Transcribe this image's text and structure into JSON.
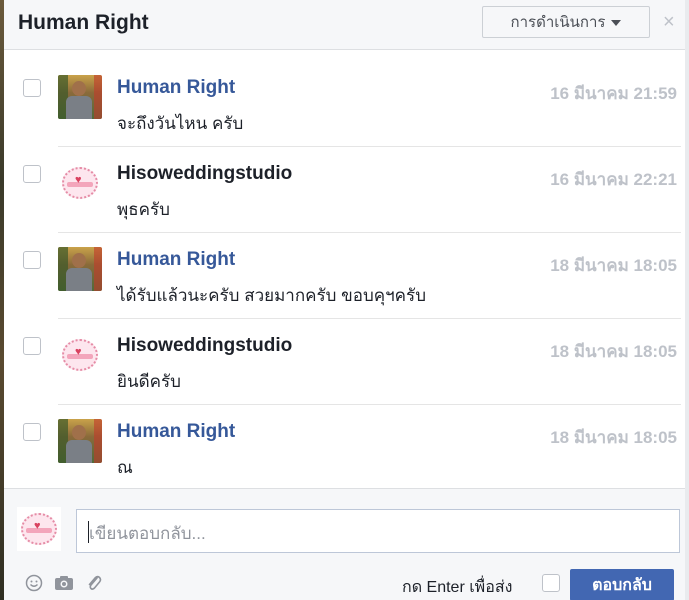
{
  "header": {
    "title": "Human Right",
    "actions_label": "การดำเนินการ",
    "close_symbol": "×"
  },
  "messages": [
    {
      "sender": "Human Right",
      "sender_type": "link",
      "avatar": "person-photo",
      "time": "16 มีนาคม 21:59",
      "text": "จะถึงวันไหน ครับ"
    },
    {
      "sender": "Hisoweddingstudio",
      "sender_type": "plain",
      "avatar": "studio-logo",
      "time": "16 มีนาคม 22:21",
      "text": "พุธครับ"
    },
    {
      "sender": "Human Right",
      "sender_type": "link",
      "avatar": "person-photo",
      "time": "18 มีนาคม 18:05",
      "text": "ได้รับแล้วนะครับ สวยมากครับ ขอบคุฯครับ"
    },
    {
      "sender": "Hisoweddingstudio",
      "sender_type": "plain",
      "avatar": "studio-logo",
      "time": "18 มีนาคม 18:05",
      "text": "ยินดีครับ"
    },
    {
      "sender": "Human Right",
      "sender_type": "link",
      "avatar": "person-photo",
      "time": "18 มีนาคม 18:05",
      "text": "ณ"
    }
  ],
  "composer": {
    "placeholder": "เขียนตอบกลับ...",
    "enter_hint": "กด Enter เพื่อส่ง",
    "reply_label": "ตอบกลับ",
    "icons": [
      "smiley-icon",
      "camera-icon",
      "paperclip-icon"
    ]
  },
  "colors": {
    "link": "#365899",
    "button": "#4267b2",
    "timestamp": "#bec2c9"
  }
}
